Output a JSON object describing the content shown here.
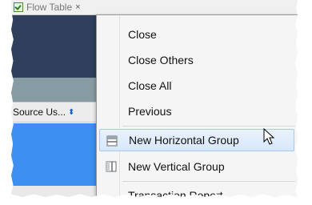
{
  "tab": {
    "title": "Flow Table",
    "close_glyph": "×",
    "icon": "flow-table-check-icon"
  },
  "grid": {
    "column_header": "Source Us...",
    "sort_glyph": "⬍",
    "colors": {
      "navy": "#2f3f5c",
      "gray": "#879ba3",
      "blue": "#3d8ff2"
    }
  },
  "menu": {
    "items": [
      {
        "label": "Close"
      },
      {
        "label": "Close Others"
      },
      {
        "label": "Close All"
      },
      {
        "label": "Previous"
      },
      {
        "label": "New Horizontal Group",
        "icon": "horizontal-split-icon",
        "highlighted": true
      },
      {
        "label": "New Vertical Group",
        "icon": "vertical-split-icon"
      },
      {
        "label": "Transaction Report..."
      }
    ],
    "highlight_color": "#d7e7fb"
  }
}
